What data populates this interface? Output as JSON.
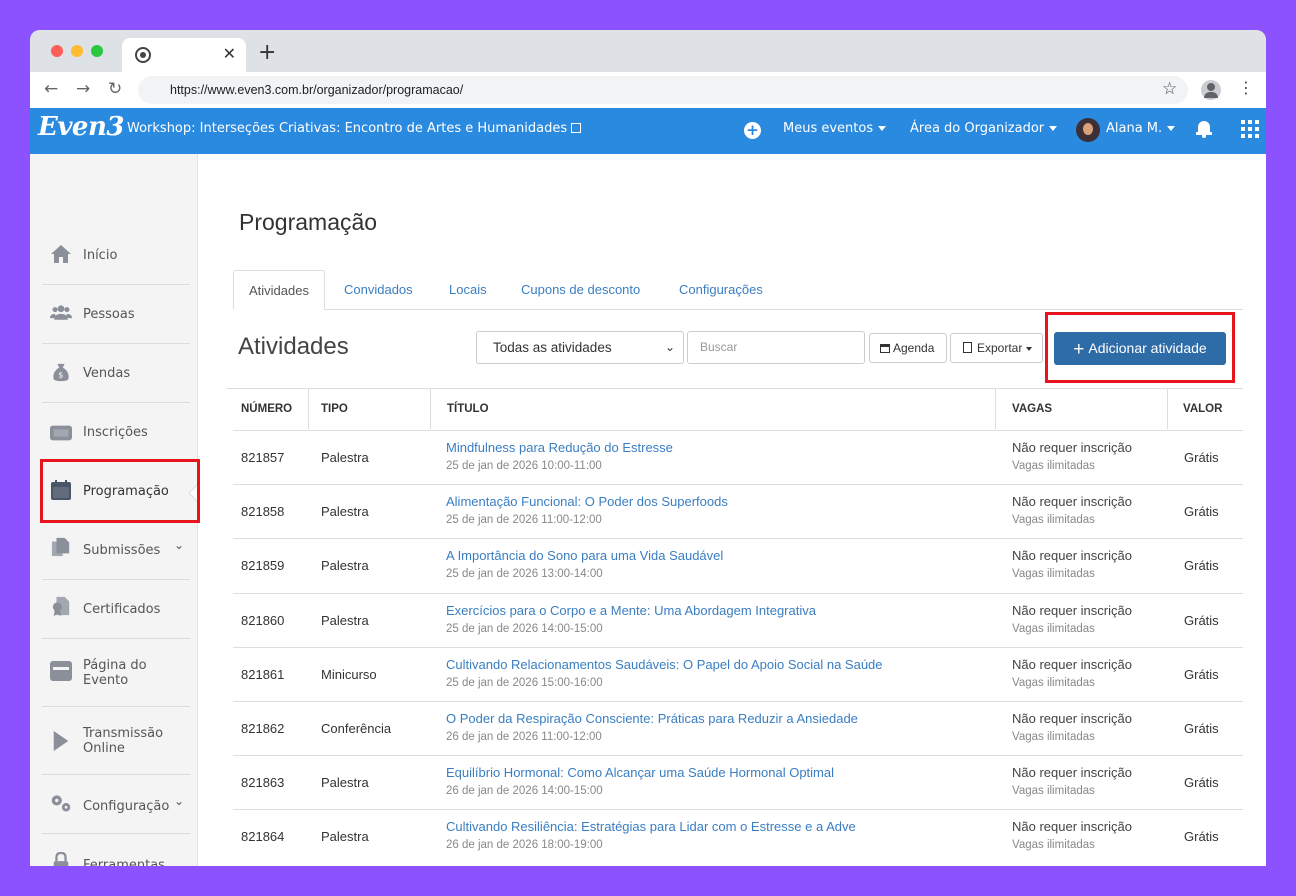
{
  "browser": {
    "url": "https://www.even3.com.br/organizador/programacao/",
    "close_glyph": "✕",
    "newtab_glyph": "+",
    "back_glyph": "←",
    "forward_glyph": "→",
    "reload_glyph": "↻",
    "star_glyph": "☆",
    "kebab_glyph": "⋮"
  },
  "header": {
    "logo": "Even3",
    "event_title": "Workshop: Interseções Criativas: Encontro de Artes e Humanidades",
    "plus_glyph": "+",
    "meus_eventos": "Meus eventos",
    "area_organizador": "Área do Organizador",
    "user_name": "Alana M.",
    "brand_color": "#2a8ae0"
  },
  "sidebar": {
    "items": [
      {
        "label": "Início",
        "icon": "home-icon"
      },
      {
        "label": "Pessoas",
        "icon": "people-icon"
      },
      {
        "label": "Vendas",
        "icon": "money-bag-icon"
      },
      {
        "label": "Inscrições",
        "icon": "ticket-icon"
      },
      {
        "label": "Programação",
        "icon": "calendar-icon"
      },
      {
        "label": "Submissões",
        "icon": "documents-icon"
      },
      {
        "label": "Certificados",
        "icon": "certificate-icon"
      },
      {
        "label": "Página do",
        "label2": "Evento",
        "icon": "browser-icon"
      },
      {
        "label": "Transmissão",
        "label2": "Online",
        "icon": "play-icon"
      },
      {
        "label": "Configuração",
        "icon": "gears-icon"
      },
      {
        "label": "Ferramentas",
        "icon": "lock-icon"
      }
    ],
    "chevron": "⌄"
  },
  "main": {
    "page_title": "Programação",
    "tabs": [
      "Atividades",
      "Convidados",
      "Locais",
      "Cupons de desconto",
      "Configurações"
    ],
    "section_title": "Atividades",
    "filter_selected": "Todas as atividades",
    "search_placeholder": "Buscar",
    "agenda_label": "Agenda",
    "exportar_label": "Exportar",
    "add_label": "Adicionar atividade",
    "add_plus": "+",
    "select_chevron": "⌄",
    "primary_color": "#2e6ca8",
    "link_color": "#3a7ec2",
    "highlight_color": "#e8141d"
  },
  "table": {
    "headers": [
      "NÚMERO",
      "TIPO",
      "TÍTULO",
      "VAGAS",
      "VALOR"
    ],
    "rows": [
      {
        "numero": "821857",
        "tipo": "Palestra",
        "titulo": "Mindfulness para Redução do Estresse",
        "data": "25 de jan de 2026 10:00-11:00",
        "vagas": "Não requer inscrição",
        "vagas_sub": "Vagas ilimitadas",
        "valor": "Grátis"
      },
      {
        "numero": "821858",
        "tipo": "Palestra",
        "titulo": "Alimentação Funcional: O Poder dos Superfoods",
        "data": "25 de jan de 2026 11:00-12:00",
        "vagas": "Não requer inscrição",
        "vagas_sub": "Vagas ilimitadas",
        "valor": "Grátis"
      },
      {
        "numero": "821859",
        "tipo": "Palestra",
        "titulo": "A Importância do Sono para uma Vida Saudável",
        "data": "25 de jan de 2026 13:00-14:00",
        "vagas": "Não requer inscrição",
        "vagas_sub": "Vagas ilimitadas",
        "valor": "Grátis"
      },
      {
        "numero": "821860",
        "tipo": "Palestra",
        "titulo": "Exercícios para o Corpo e a Mente: Uma Abordagem Integrativa",
        "data": "25 de jan de 2026 14:00-15:00",
        "vagas": "Não requer inscrição",
        "vagas_sub": "Vagas ilimitadas",
        "valor": "Grátis"
      },
      {
        "numero": "821861",
        "tipo": "Minicurso",
        "titulo": "Cultivando Relacionamentos Saudáveis: O Papel do Apoio Social na Saúde",
        "data": "25 de jan de 2026 15:00-16:00",
        "vagas": "Não requer inscrição",
        "vagas_sub": "Vagas ilimitadas",
        "valor": "Grátis"
      },
      {
        "numero": "821862",
        "tipo": "Conferência",
        "titulo": "O Poder da Respiração Consciente: Práticas para Reduzir a Ansiedade",
        "data": "26 de jan de 2026 11:00-12:00",
        "vagas": "Não requer inscrição",
        "vagas_sub": "Vagas ilimitadas",
        "valor": "Grátis"
      },
      {
        "numero": "821863",
        "tipo": "Palestra",
        "titulo": "Equilíbrio Hormonal: Como Alcançar uma Saúde Hormonal Optimal",
        "data": "26 de jan de 2026 14:00-15:00",
        "vagas": "Não requer inscrição",
        "vagas_sub": "Vagas ilimitadas",
        "valor": "Grátis"
      },
      {
        "numero": "821864",
        "tipo": "Palestra",
        "titulo": "Cultivando Resiliência: Estratégias para Lidar com o Estresse e a Adve",
        "data": "26 de jan de 2026 18:00-19:00",
        "vagas": "Não requer inscrição",
        "vagas_sub": "Vagas ilimitadas",
        "valor": "Grátis"
      }
    ]
  }
}
